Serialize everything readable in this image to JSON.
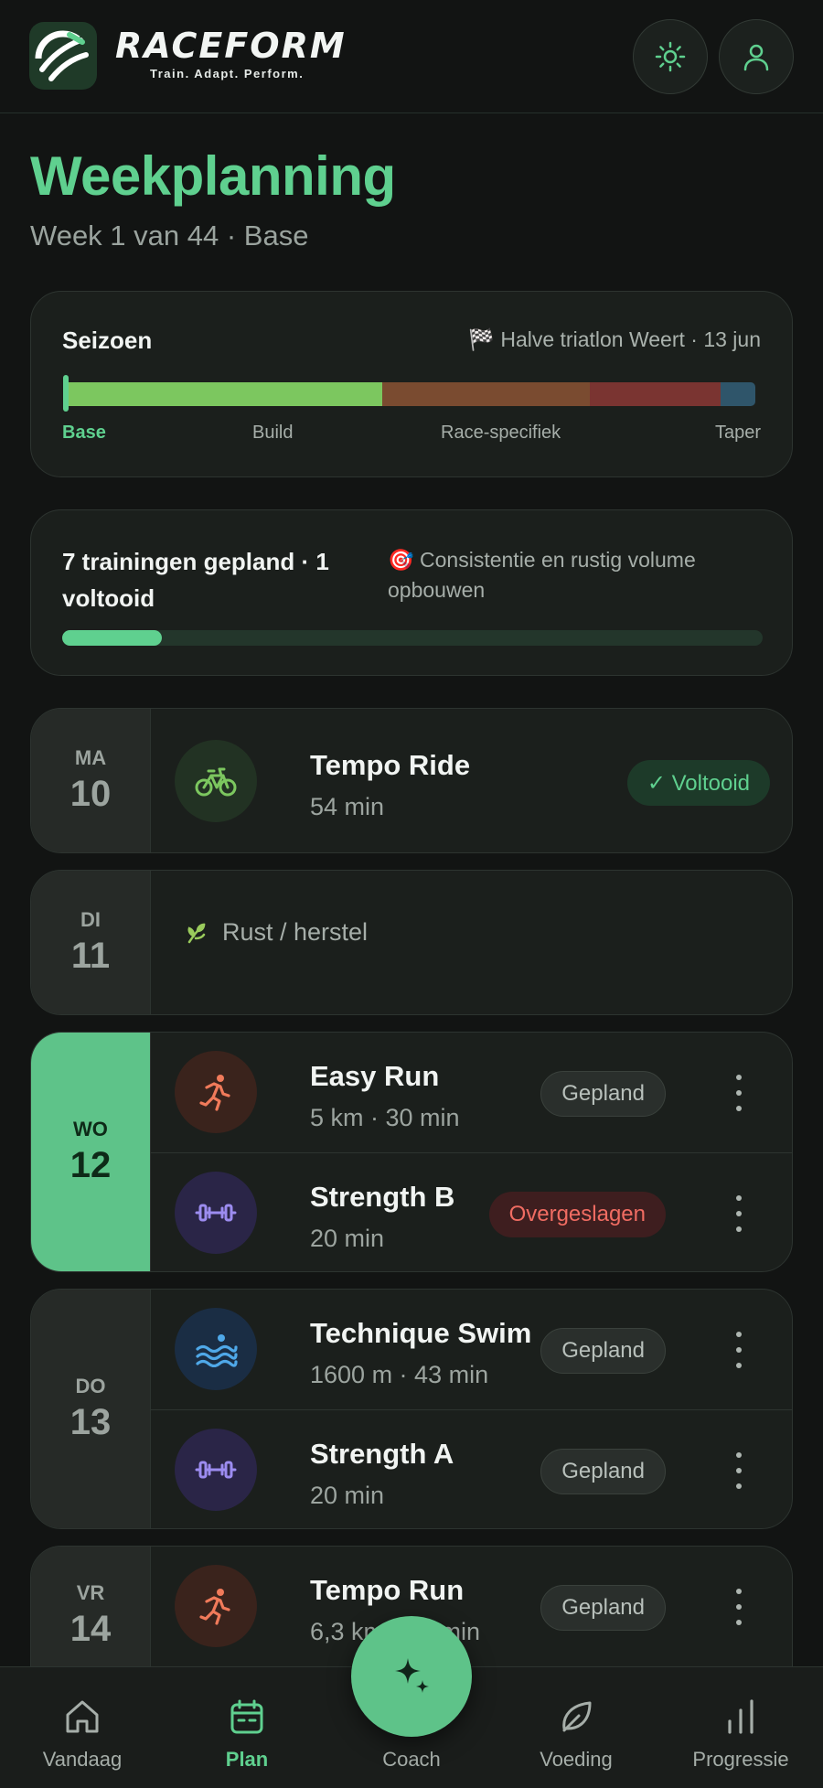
{
  "app": {
    "brand": "RACEFORM",
    "tagline": "Train. Adapt. Perform."
  },
  "page": {
    "title": "Weekplanning",
    "subtitle": "Week 1 van 44 · Base"
  },
  "season": {
    "title": "Seizoen",
    "race": "🏁 Halve triatlon Weert · 13 jun",
    "progress_fraction": 0.01,
    "phases": [
      {
        "label": "Base",
        "share": 0.46,
        "color": "#7cc75f"
      },
      {
        "label": "Build",
        "share": 0.3,
        "color": "#7a4b30"
      },
      {
        "label": "Race-specifiek",
        "share": 0.19,
        "color": "#7a3431"
      },
      {
        "label": "Taper",
        "share": 0.05,
        "color": "#2f556a"
      }
    ]
  },
  "summary": {
    "text": "7 trainingen gepland · 1 voltooid",
    "goal": "🎯 Consistentie en rustig volume opbouwen",
    "completed": 1,
    "planned": 7
  },
  "days": [
    {
      "abbr": "MA",
      "num": "10",
      "sessions": [
        {
          "name": "Tempo Ride",
          "meta": "54 min",
          "status": "✓ Voltooid",
          "icon": "bike-icon"
        }
      ]
    },
    {
      "abbr": "DI",
      "num": "11",
      "rest": "Rust / herstel"
    },
    {
      "abbr": "WO",
      "num": "12",
      "sessions": [
        {
          "name": "Easy Run",
          "meta": "5 km · 30 min",
          "status": "Gepland",
          "icon": "run-icon"
        },
        {
          "name": "Strength B",
          "meta": "20 min",
          "status": "Overgeslagen",
          "icon": "dumbbell-icon"
        }
      ]
    },
    {
      "abbr": "DO",
      "num": "13",
      "sessions": [
        {
          "name": "Technique Swim",
          "meta": "1600 m · 43 min",
          "status": "Gepland",
          "icon": "swim-icon"
        },
        {
          "name": "Strength A",
          "meta": "20 min",
          "status": "Gepland",
          "icon": "dumbbell-icon"
        }
      ]
    },
    {
      "abbr": "VR",
      "num": "14",
      "sessions": [
        {
          "name": "Tempo Run",
          "meta": "6,3 km · 38 min",
          "status": "Gepland",
          "icon": "run-icon"
        }
      ]
    }
  ],
  "nav": {
    "items": [
      {
        "label": "Vandaag",
        "icon": "home-icon"
      },
      {
        "label": "Plan",
        "icon": "calendar-icon"
      },
      {
        "label": "Coach",
        "icon": "sparkle-icon"
      },
      {
        "label": "Voeding",
        "icon": "leaf-icon"
      },
      {
        "label": "Progressie",
        "icon": "bars-icon"
      }
    ]
  },
  "colors": {
    "accent": "#5fd08f",
    "background": "#121413",
    "card": "#1b1f1c",
    "skipped": "#f06c62"
  }
}
